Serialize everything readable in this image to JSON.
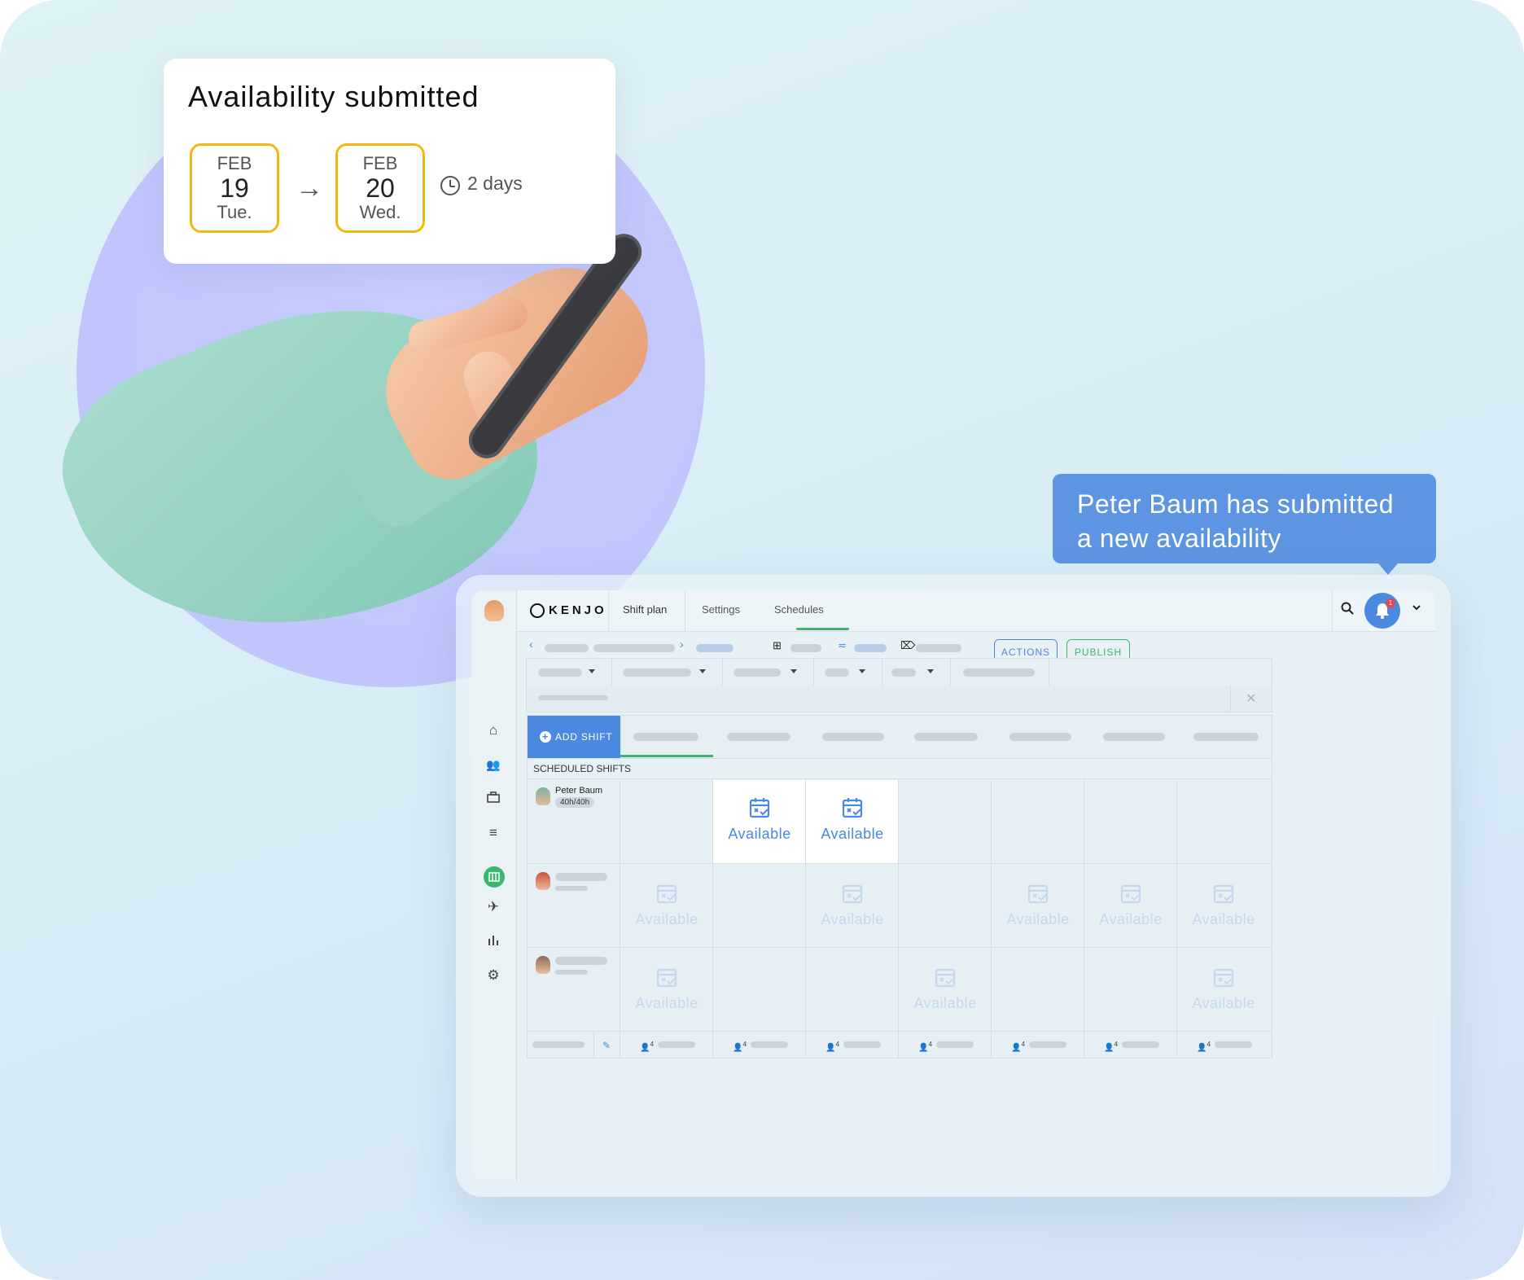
{
  "availability_card": {
    "title": "Availability submitted",
    "from": {
      "month": "FEB",
      "day": "19",
      "weekday": "Tue."
    },
    "to": {
      "month": "FEB",
      "day": "20",
      "weekday": "Wed."
    },
    "duration": "2 days"
  },
  "notification": {
    "line1": "Peter Baum has submitted",
    "line2": "a new availability"
  },
  "app": {
    "logo": "KENJO",
    "tabs": [
      "Shift plan",
      "Settings",
      "Schedules"
    ],
    "active_tab": "Schedules",
    "notification_count": "1",
    "toolbar": {
      "actions_label": "ACTIONS",
      "publish_label": "PUBLISH"
    },
    "grid": {
      "add_shift_label": "ADD SHIFT",
      "section_label": "SCHEDULED SHIFTS",
      "employee": {
        "name": "Peter Baum",
        "hours": "40h/40h"
      },
      "available_label": "Available",
      "footer_count": "4"
    }
  },
  "colors": {
    "accent_blue": "#4a89e0",
    "accent_green": "#3bb66f",
    "date_border": "#f3b80f",
    "tooltip_bg": "#5d95e3"
  },
  "icons": [
    "clock-icon",
    "arrow-right-icon",
    "search-icon",
    "bell-icon",
    "chevron-down-icon",
    "home-icon",
    "people-icon",
    "briefcase-icon",
    "list-icon",
    "calendar-grid-icon",
    "plane-icon",
    "bar-chart-icon",
    "gear-icon",
    "calendar-check-icon",
    "pencil-icon",
    "person-icon"
  ]
}
